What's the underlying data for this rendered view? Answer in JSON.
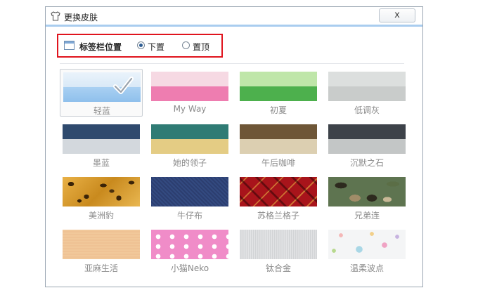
{
  "dialog": {
    "title": "更换皮肤",
    "close_label": "x"
  },
  "tabbar": {
    "label": "标签栏位置",
    "options": [
      {
        "label": "下置",
        "selected": true
      },
      {
        "label": "置顶",
        "selected": false
      }
    ]
  },
  "skins": [
    {
      "name": "轻蓝",
      "selected": true
    },
    {
      "name": "My Way",
      "selected": false
    },
    {
      "name": "初夏",
      "selected": false
    },
    {
      "name": "低调灰",
      "selected": false
    },
    {
      "name": "墨蓝",
      "selected": false
    },
    {
      "name": "她的领子",
      "selected": false
    },
    {
      "name": "午后咖啡",
      "selected": false
    },
    {
      "name": "沉默之石",
      "selected": false
    },
    {
      "name": "美洲豹",
      "selected": false
    },
    {
      "name": "牛仔布",
      "selected": false
    },
    {
      "name": "苏格兰格子",
      "selected": false
    },
    {
      "name": "兄弟连",
      "selected": false
    },
    {
      "name": "亚麻生活",
      "selected": false
    },
    {
      "name": "小猫Neko",
      "selected": false
    },
    {
      "name": "钛合金",
      "selected": false
    },
    {
      "name": "温柔波点",
      "selected": false
    }
  ],
  "colors": {
    "accent_border": "#e0141e",
    "title_bar_line": "#a9cdef"
  }
}
